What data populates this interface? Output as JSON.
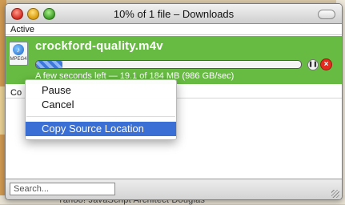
{
  "window": {
    "title": "10% of 1 file – Downloads"
  },
  "sections": {
    "active": "Active",
    "completed": "Co"
  },
  "download": {
    "filename": "crockford-quality.m4v",
    "icon_label": "MPEG4",
    "icon": "quicktime-file-icon",
    "progress": 0.1,
    "status": "A few seconds left — 19.1 of 184 MB (986 GB/sec)",
    "row_color": "#67bb42"
  },
  "context_menu": {
    "items": [
      "Pause",
      "Cancel",
      "Copy Source Location"
    ],
    "highlighted": "Copy Source Location",
    "highlight_color": "#3a6fd6"
  },
  "search": {
    "placeholder": "Search..."
  },
  "background": {
    "bottom_text": "Yahoo! JavaScript Architect Douglas"
  }
}
